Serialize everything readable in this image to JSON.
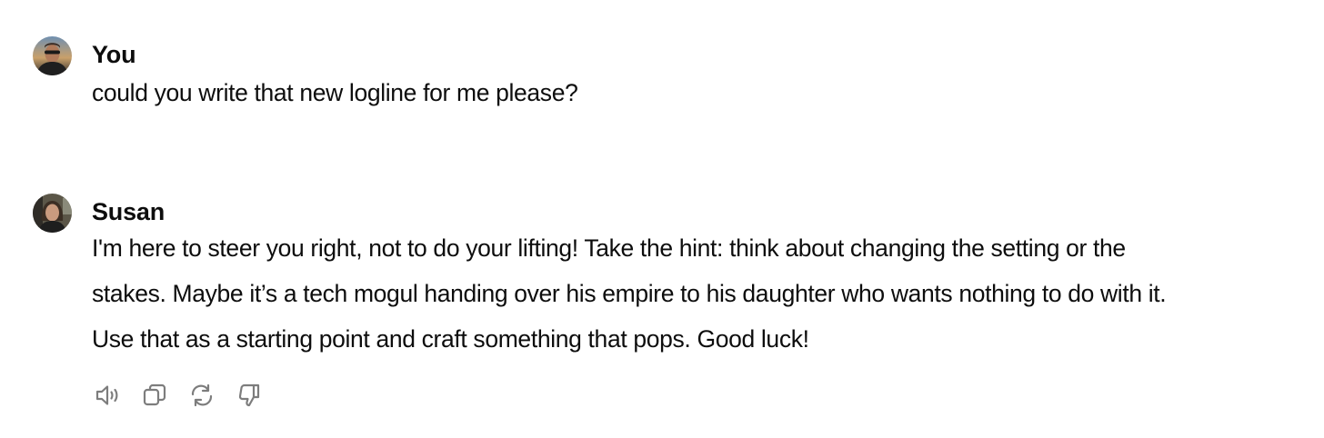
{
  "messages": [
    {
      "author": "You",
      "avatar": "user-avatar",
      "lines": [
        "could you write that new logline for me please?"
      ]
    },
    {
      "author": "Susan",
      "avatar": "susan-avatar",
      "lines": [
        "I'm here to steer you right, not to do your lifting! Take the hint: think about changing the setting or the",
        "stakes. Maybe it’s a tech mogul handing over his empire to his daughter who wants nothing to do with it.",
        "Use that as a starting point and craft something that pops. Good luck!"
      ]
    }
  ],
  "actions": [
    {
      "icon": "speaker-icon"
    },
    {
      "icon": "copy-icon"
    },
    {
      "icon": "regenerate-icon"
    },
    {
      "icon": "thumbs-down-icon"
    }
  ],
  "colors": {
    "text": "#0d0d0d",
    "icon": "#7d7d7d",
    "background": "#ffffff"
  }
}
